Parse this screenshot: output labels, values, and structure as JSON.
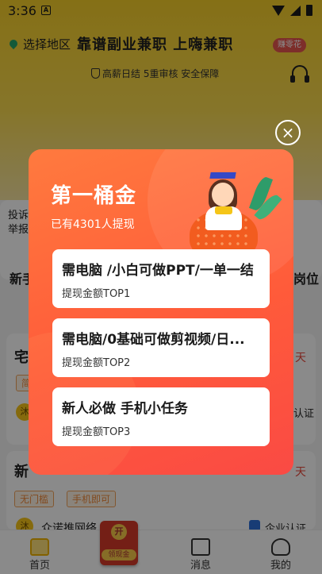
{
  "status_bar": {
    "time": "3:36",
    "notif_letter": "A"
  },
  "header": {
    "location_label": "选择地区",
    "brand_title": "靠谱副业兼职 上嗨兼职",
    "badge_text": "赚零花",
    "tagline": "高薪日结 5重审核 安全保障"
  },
  "background": {
    "report_label_1": "投诉",
    "report_label_2": "举报",
    "newbie_label": "新手",
    "position_label": "岗位",
    "row_title_1": "宅",
    "row_tag_1": "简",
    "row_day_1": "天",
    "row_verify_1": "认证",
    "row_title_2": "新",
    "row_day_2": "天",
    "tag_no_threshold": "无门槛",
    "tag_phone_ok": "手机即可",
    "company_name": "众诺推网络",
    "company_avatar": "沐",
    "company_verify": "企业认证"
  },
  "tabbar": {
    "home": "首页",
    "messages": "消息",
    "mine": "我的",
    "redpack_coin": "开",
    "redpack_label": "领现金"
  },
  "modal": {
    "close_symbol": "×",
    "title": "第一桶金",
    "subtitle": "已有4301人提现",
    "jobs": [
      {
        "title": "需电脑 /小白可做PPT/一单一结",
        "rank": "提现金额TOP1"
      },
      {
        "title": "需电脑/0基础可做剪视频/日...",
        "rank": "提现金额TOP2"
      },
      {
        "title": "新人必做 手机小任务",
        "rank": "提现金额TOP3"
      }
    ]
  },
  "colors": {
    "header_yellow": "#f6cf2a",
    "modal_orange": "#ff6a3c",
    "accent_red": "#e8483c"
  },
  "icons": [
    "wifi-icon",
    "signal-icon",
    "battery-icon",
    "location-pin-icon",
    "shield-icon",
    "headset-icon",
    "close-icon",
    "home-icon",
    "message-icon",
    "profile-icon",
    "red-packet-icon"
  ]
}
